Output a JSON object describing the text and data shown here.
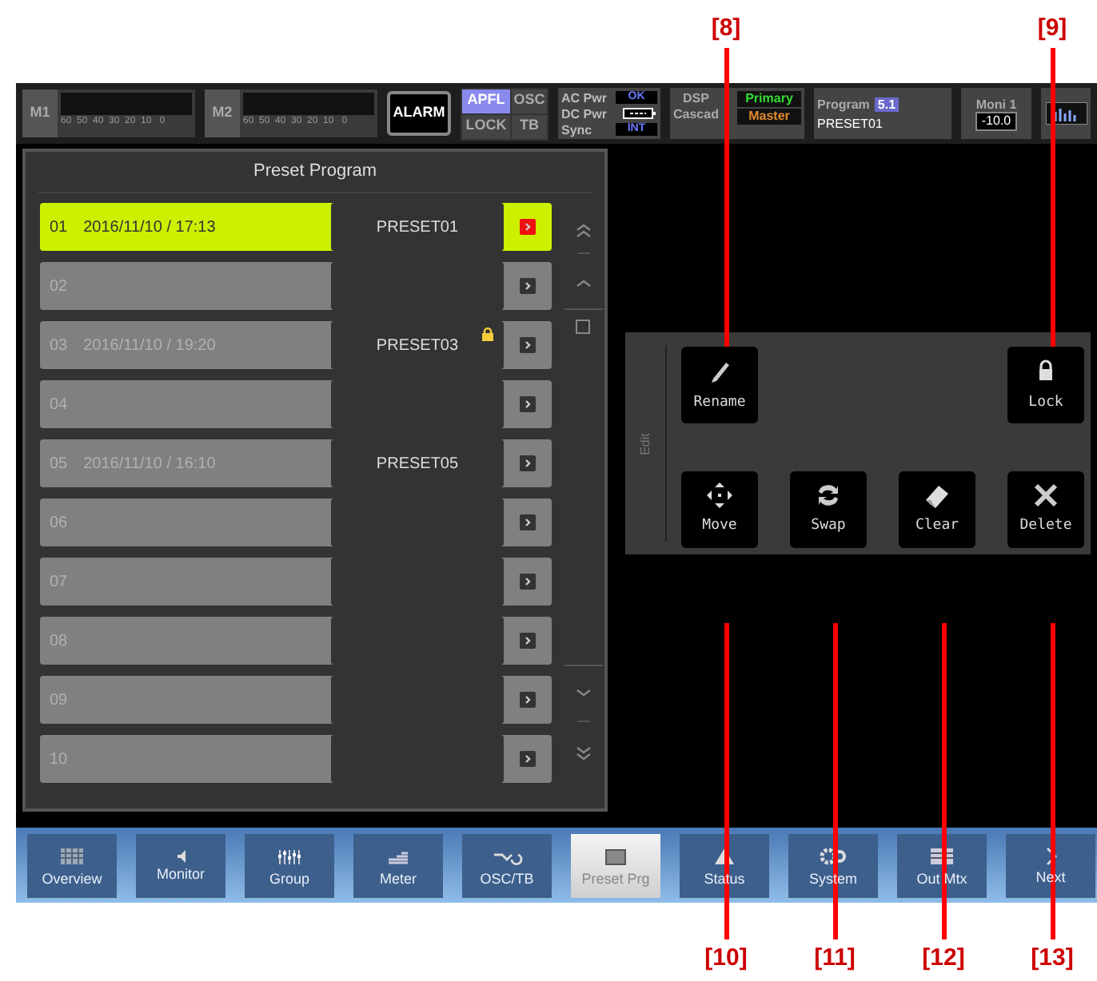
{
  "callouts": [
    "[8]",
    "[9]",
    "[10]",
    "[11]",
    "[12]",
    "[13]"
  ],
  "header": {
    "meters": [
      {
        "label": "M1",
        "scale": "60  50  40  30  20  10   0"
      },
      {
        "label": "M2",
        "scale": "60  50  40  30  20  10   0"
      }
    ],
    "alarm": "ALARM",
    "monitor_buttons": [
      {
        "label": "APFL",
        "selected": true
      },
      {
        "label": "OSC",
        "selected": false
      },
      {
        "label": "LOCK",
        "selected": false
      },
      {
        "label": "TB",
        "selected": false
      }
    ],
    "power": [
      {
        "label": "AC Pwr",
        "kind": "text",
        "indicator": "OK"
      },
      {
        "label": "DC Pwr",
        "kind": "battery"
      },
      {
        "label": "Sync",
        "kind": "text",
        "indicator": "INT"
      }
    ],
    "dsp": {
      "label": "DSP",
      "label_2": "Cascad",
      "primary": "Primary",
      "master": "Master"
    },
    "program": {
      "label": "Program",
      "number": "5.1",
      "name": "PRESET01"
    },
    "moni": {
      "label": "Moni 1",
      "value": "-10.0"
    }
  },
  "preset_program": {
    "title": "Preset Program",
    "rows": [
      {
        "number": "01",
        "date": "2016/11/10 / 17:13",
        "name": "PRESET01",
        "selected": true,
        "locked": false
      },
      {
        "number": "02",
        "selected": false,
        "locked": false
      },
      {
        "number": "03",
        "date": "2016/11/10 / 19:20",
        "name": "PRESET03",
        "selected": false,
        "locked": true
      },
      {
        "number": "04",
        "selected": false,
        "locked": false
      },
      {
        "number": "05",
        "date": "2016/11/10 / 16:10",
        "name": "PRESET05",
        "selected": false,
        "locked": false
      },
      {
        "number": "06",
        "selected": false,
        "locked": false
      },
      {
        "number": "07",
        "selected": false,
        "locked": false
      },
      {
        "number": "08",
        "selected": false,
        "locked": false
      },
      {
        "number": "09",
        "selected": false,
        "locked": false
      },
      {
        "number": "10",
        "selected": false,
        "locked": false
      }
    ]
  },
  "edit": {
    "label": "Edit",
    "buttons": [
      {
        "label": "Rename",
        "kind": "rename"
      },
      {
        "label": "Lock",
        "kind": "lock"
      },
      {
        "label": "Move",
        "kind": "move"
      },
      {
        "label": "Swap",
        "kind": "swap"
      },
      {
        "label": "Clear",
        "kind": "clear"
      },
      {
        "label": "Delete",
        "kind": "delete"
      }
    ]
  },
  "nav": [
    {
      "label": "Overview",
      "kind": "overview",
      "selected": false
    },
    {
      "label": "Monitor",
      "kind": "monitor",
      "selected": false
    },
    {
      "label": "Group",
      "kind": "group",
      "selected": false
    },
    {
      "label": "Meter",
      "kind": "meter",
      "selected": false
    },
    {
      "label": "OSC/TB",
      "kind": "osc",
      "selected": false
    },
    {
      "label": "Preset Prg",
      "kind": "preset",
      "selected": true
    },
    {
      "label": "Status",
      "kind": "status",
      "selected": false
    },
    {
      "label": "System",
      "kind": "system",
      "selected": false
    },
    {
      "label": "Out Mtx",
      "kind": "outmtx",
      "selected": false
    },
    {
      "label": "Next",
      "kind": "next",
      "selected": false
    }
  ]
}
